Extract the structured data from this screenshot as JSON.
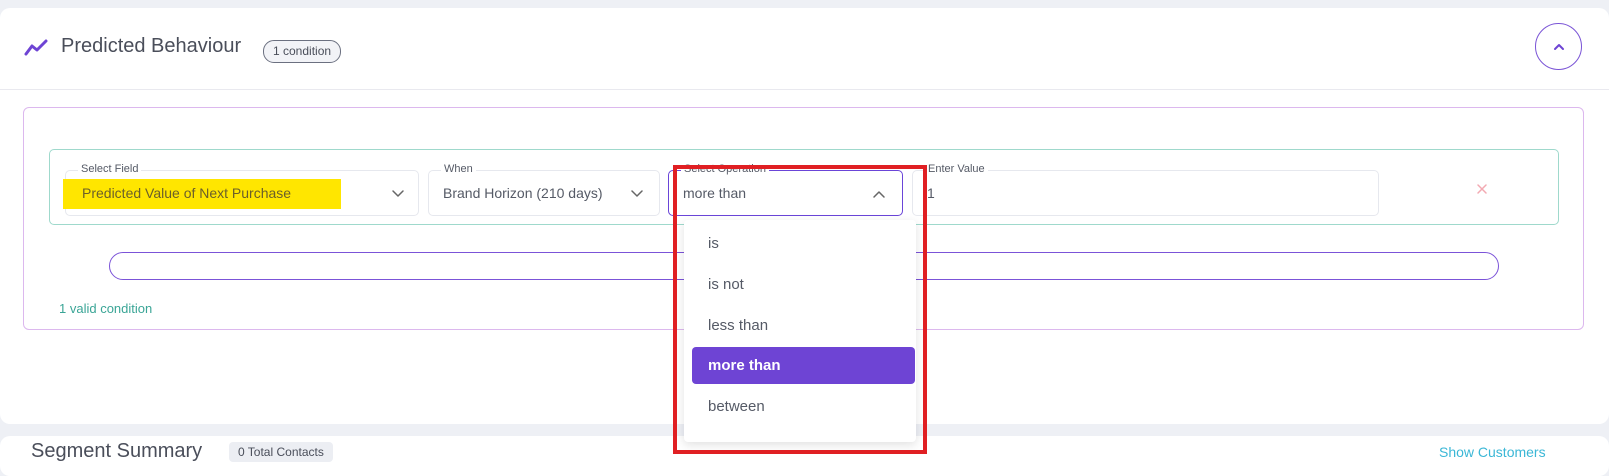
{
  "section": {
    "title": "Predicted Behaviour",
    "condition_badge": "1 condition"
  },
  "condition": {
    "select_field": {
      "label": "Select Field",
      "value": "Predicted Value of Next Purchase"
    },
    "when": {
      "label": "When",
      "value": "Brand Horizon (210 days)"
    },
    "select_operation": {
      "label": "Select Operation",
      "value": "more than"
    },
    "enter_value": {
      "label": "Enter Value",
      "value": "1"
    }
  },
  "operation_options": [
    "is",
    "is not",
    "less than",
    "more than",
    "between"
  ],
  "selected_operation": "more than",
  "valid_conditions_text": "1 valid condition",
  "summary": {
    "title": "Segment Summary",
    "badge": "0 Total Contacts",
    "link": "Show Customers"
  },
  "colors": {
    "accent_purple": "#6e44d4",
    "highlight_yellow": "#ffe600",
    "valid_teal": "#3aa596",
    "annotation_red": "#e01f23"
  }
}
